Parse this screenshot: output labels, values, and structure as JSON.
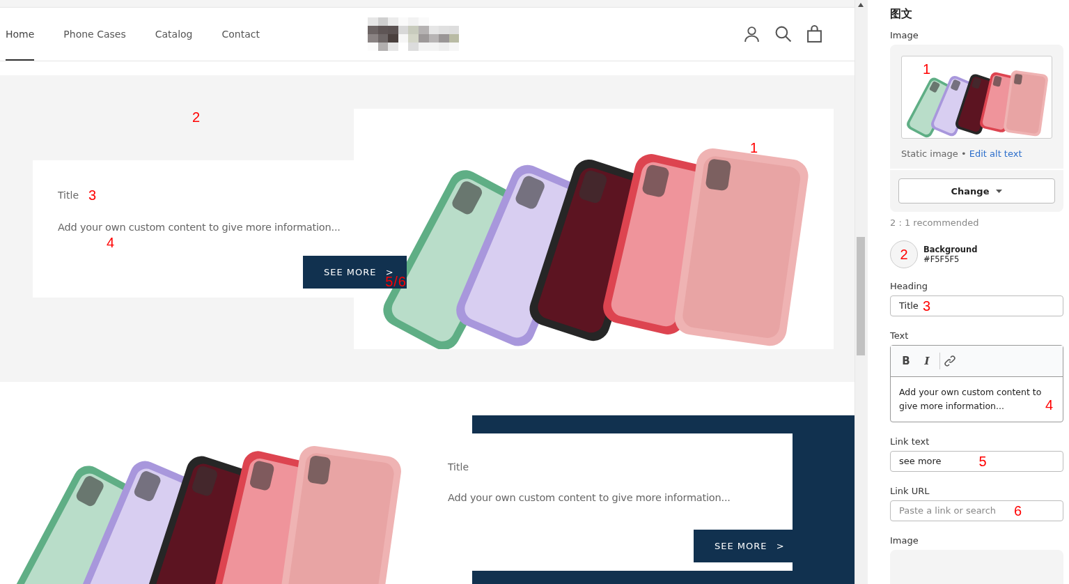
{
  "nav": {
    "links": [
      {
        "label": "Home",
        "selected": true
      },
      {
        "label": "Phone Cases",
        "selected": false
      },
      {
        "label": "Catalog",
        "selected": false
      },
      {
        "label": "Contact",
        "selected": false
      }
    ]
  },
  "sections": [
    {
      "kind": "image_right",
      "title": "Title",
      "text": "Add your own custom content to give more information...",
      "button": "SEE MORE",
      "button_arrow": ">",
      "annotations": {
        "section": "2",
        "image": "1",
        "title": "3",
        "text": "4",
        "button": "5/6"
      }
    },
    {
      "kind": "image_left",
      "title": "Title",
      "text": "Add your own custom content to give more information...",
      "button": "SEE MORE",
      "button_arrow": ">"
    }
  ],
  "editor": {
    "title": "图文",
    "image_label": "Image",
    "image_annotation": "1",
    "image_caption": "Static image",
    "caption_separator": "•",
    "alt_link": "Edit alt text",
    "change_button": "Change",
    "ratio_note": "2 : 1 recommended",
    "background": {
      "label": "Background",
      "value": "#F5F5F5",
      "annotation": "2"
    },
    "heading": {
      "label": "Heading",
      "value": "Title",
      "annotation": "3"
    },
    "text": {
      "label": "Text",
      "toolbar": [
        "B",
        "I"
      ],
      "value": "Add your own custom content to give more information...",
      "annotation": "4"
    },
    "link_text": {
      "label": "Link text",
      "value": "see more",
      "annotation": "5"
    },
    "link_url": {
      "label": "Link URL",
      "placeholder": "Paste a link or search",
      "annotation": "6"
    },
    "image2_label": "Image"
  }
}
